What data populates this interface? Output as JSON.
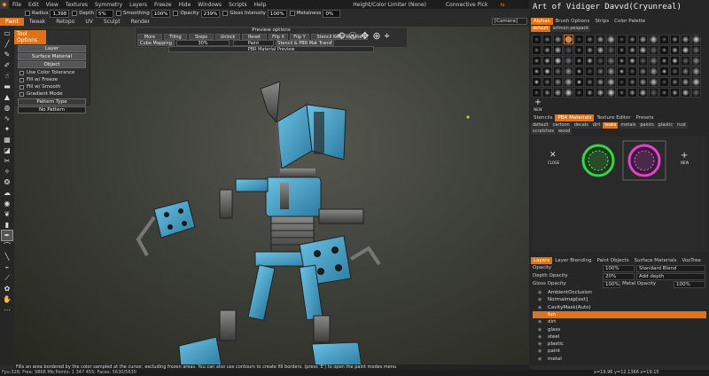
{
  "menu": {
    "items": [
      "File",
      "Edit",
      "View",
      "Textures",
      "Symmetry",
      "Layers",
      "Freeze",
      "Hide",
      "Windows",
      "Scripts",
      "Help"
    ],
    "color_limiter": "Height/Color Limiter (None)",
    "connective": "Connective Pick",
    "alt_icon": "⇆"
  },
  "brush_params": [
    {
      "label": "Radius",
      "value": "1,398"
    },
    {
      "label": "Depth",
      "value": "5%"
    },
    {
      "label": "Smoothing",
      "value": "100%"
    },
    {
      "label": "Opacity",
      "value": "239%"
    },
    {
      "label": "Gloss Intensity",
      "value": "100%"
    },
    {
      "label": "Metalness",
      "value": "0%"
    }
  ],
  "rooms": [
    "Paint",
    "Tweak",
    "Retopo",
    "UV",
    "Sculpt",
    "Render"
  ],
  "active_room": "Paint",
  "tool_options": {
    "header": "Tool Options",
    "layer_btn": "Layer",
    "surface_btn": "Surface Material",
    "object_btn": "Object",
    "options": [
      "Use Color Tolerance",
      "Fill w/ Freeze",
      "Fill w/ Smooth",
      "Gradient Mode"
    ],
    "pattern_label": "Pattern Type",
    "pattern_value": "No Pattern"
  },
  "preview_options": {
    "title": "Preview options",
    "buttons": [
      "More",
      "Tiling",
      "Steps",
      "Unlock",
      "Reset",
      "Flip X",
      "Flip Y",
      "Stencil Keep Volume"
    ],
    "cube_mapping": "Cube Mapping",
    "percent": "30%",
    "paint": "Paint",
    "stencil_pbr": "Stencil & PBR Mat Transf",
    "pbr_preview": "PBR Material Preview",
    "icons": [
      "⟲",
      "☉",
      "✥",
      "⊕",
      "⌖"
    ]
  },
  "camera": "[Camera]",
  "watermark": "Art of Vidiger Davvd(Cryunreal)",
  "alphas_tabs": [
    "Alphas",
    "Brush Options",
    "Strips",
    "Color Palette"
  ],
  "alphas_subtabs": [
    "default",
    "artmon pespack"
  ],
  "alpha_new": "NEW",
  "materials_tabs": [
    "Stencils",
    "PBR Materials",
    "Texture Editor",
    "Presets"
  ],
  "materials_subtabs": [
    "default",
    "cartoon",
    "decals",
    "dirt",
    "leaks",
    "metals",
    "paints",
    "plastic",
    "rust",
    "scratches",
    "wood"
  ],
  "materials_active": "leaks",
  "mat_close": "CLOSE",
  "mat_new": "NEW",
  "layers_tabs": [
    "Layers",
    "Layer Blending",
    "Paint Objects",
    "Surface Materials",
    "VoxTree"
  ],
  "layer_params": {
    "opacity_label": "Opacity",
    "opacity": "100%",
    "blend": "Standard Blend",
    "depth_label": "Depth Opacity",
    "depth": "20%",
    "depth_mode": "Add depth",
    "gloss_label": "Gloss Opacity",
    "gloss": "100%",
    "metal_label": "Metal Opacity",
    "metal": "100%"
  },
  "layers": [
    "AmbientOcclusion",
    "Normalmap[ext]",
    "CavityMask(Auto)",
    "fun",
    "dirt",
    "glass",
    "steel",
    "plastic",
    "paint",
    "metal"
  ],
  "active_layer": "fun",
  "hint": "Fills an area bordered by the color sampled at the cursor, excluding frozen areas. You can also use contours to create fill borders. (press 'E') to open the paint modes menu",
  "stats": "Fps:328;  Free: 9868 Mb;Points: 1 347 455; Faces: 5630/5630",
  "coords": "x=19.96 y=12.1366  z=19.15",
  "colors": {
    "accent": "#e0731a",
    "robot": "#4aa3c8"
  }
}
